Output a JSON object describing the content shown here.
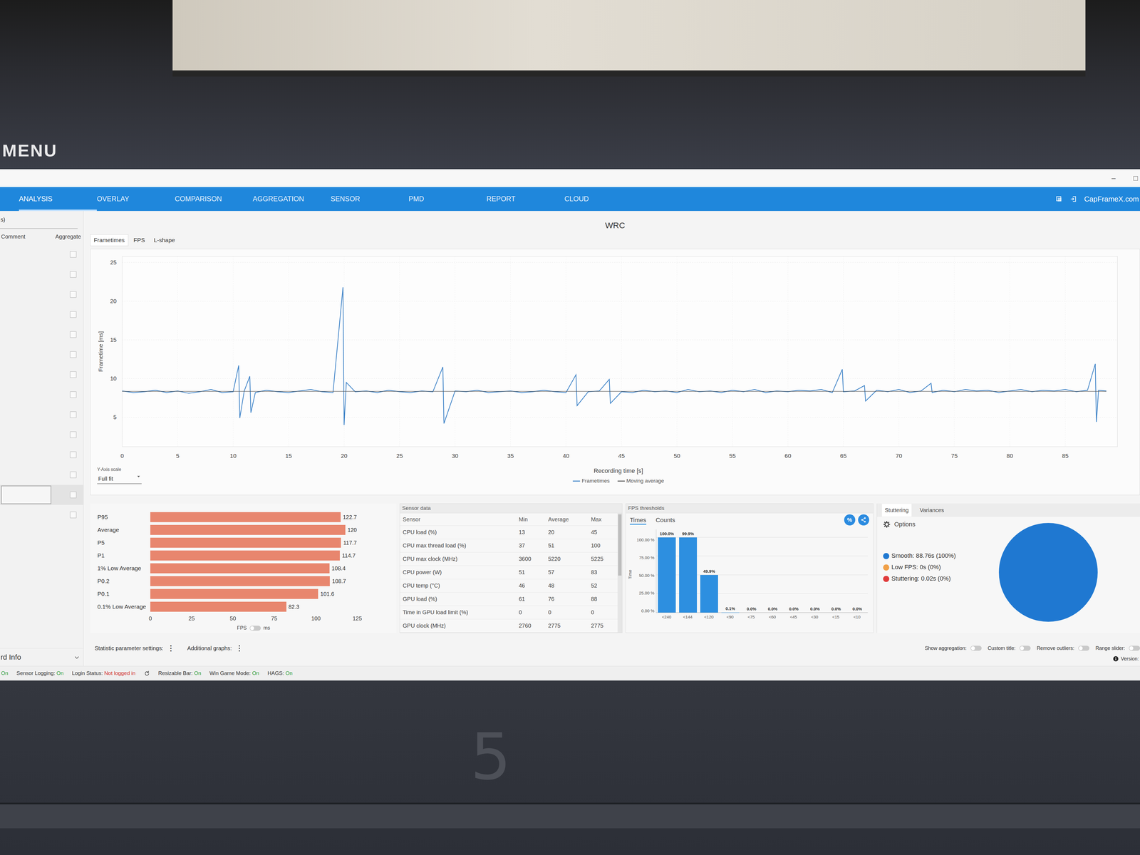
{
  "background": {
    "menu_label": "MENU",
    "counter": "5"
  },
  "window": {
    "controls": [
      "–",
      "□"
    ]
  },
  "nav": {
    "tabs": [
      {
        "label": "ANALYSIS",
        "selected": true
      },
      {
        "label": "OVERLAY",
        "selected": false
      },
      {
        "label": "COMPARISON",
        "selected": false
      },
      {
        "label": "AGGREGATION",
        "selected": false
      },
      {
        "label": "SENSOR",
        "selected": false
      },
      {
        "label": "PMD",
        "selected": false
      },
      {
        "label": "REPORT",
        "selected": false
      },
      {
        "label": "CLOUD",
        "selected": false
      }
    ],
    "site": "CapFrameX.com"
  },
  "sidebar": {
    "header_cut": "s)",
    "columns": [
      "Comment",
      "Aggregate"
    ],
    "rows": [
      {
        "checked": false,
        "selected": false
      },
      {
        "checked": false,
        "selected": false
      },
      {
        "checked": false,
        "selected": false
      },
      {
        "checked": false,
        "selected": false
      },
      {
        "checked": false,
        "selected": false
      },
      {
        "checked": false,
        "selected": false
      },
      {
        "checked": false,
        "selected": false
      },
      {
        "checked": false,
        "selected": false
      },
      {
        "checked": false,
        "selected": false
      },
      {
        "checked": false,
        "selected": false
      },
      {
        "checked": false,
        "selected": false
      },
      {
        "checked": false,
        "selected": false
      },
      {
        "checked": false,
        "selected": true
      },
      {
        "checked": false,
        "selected": false
      }
    ],
    "footer": "rd Info"
  },
  "chart": {
    "title": "WRC",
    "tabs": [
      {
        "label": "Frametimes",
        "selected": true
      },
      {
        "label": "FPS",
        "selected": false
      },
      {
        "label": "L-shape",
        "selected": false
      }
    ],
    "y_axis": {
      "label": "Frametime [ms]",
      "ticks": [
        "5",
        "10",
        "15",
        "20",
        "25"
      ],
      "min": 1.2,
      "max": 25.8
    },
    "x_axis": {
      "label": "Recording time [s]",
      "ticks": [
        "0",
        "5",
        "10",
        "15",
        "20",
        "25",
        "30",
        "35",
        "40",
        "45",
        "50",
        "55",
        "60",
        "65",
        "70",
        "75",
        "80",
        "85"
      ],
      "max": 89.7
    },
    "y_scale": {
      "label": "Y-Axis scale",
      "value": "Full fit"
    },
    "series": [
      {
        "name": "Frametimes",
        "color": "#3a80c6",
        "points": [
          [
            0,
            8.4
          ],
          [
            1,
            8.2
          ],
          [
            2,
            8.3
          ],
          [
            3,
            8.5
          ],
          [
            4,
            8.2
          ],
          [
            5,
            8.4
          ],
          [
            6,
            8.1
          ],
          [
            7,
            8.3
          ],
          [
            8,
            8.6
          ],
          [
            9,
            8.2
          ],
          [
            10,
            8.3
          ],
          [
            10.5,
            11.7
          ],
          [
            10.6,
            4.9
          ],
          [
            11,
            8.4
          ],
          [
            11.5,
            10.3
          ],
          [
            11.6,
            5.6
          ],
          [
            12,
            8.2
          ],
          [
            13,
            8.5
          ],
          [
            14,
            8.3
          ],
          [
            15,
            8.2
          ],
          [
            16,
            8.4
          ],
          [
            17,
            8.6
          ],
          [
            18,
            8.3
          ],
          [
            19,
            8.2
          ],
          [
            19.9,
            21.8
          ],
          [
            20,
            4
          ],
          [
            20.2,
            9.5
          ],
          [
            21,
            8.3
          ],
          [
            22,
            8.4
          ],
          [
            23,
            8.2
          ],
          [
            24,
            8.5
          ],
          [
            25,
            8.3
          ],
          [
            26,
            8.2
          ],
          [
            27,
            8.4
          ],
          [
            28,
            8.3
          ],
          [
            28.9,
            11.5
          ],
          [
            29,
            4.2
          ],
          [
            30,
            8.4
          ],
          [
            31,
            8.3
          ],
          [
            32,
            8.5
          ],
          [
            33,
            8.2
          ],
          [
            34,
            8.3
          ],
          [
            35,
            8.4
          ],
          [
            36,
            8.2
          ],
          [
            37,
            8.3
          ],
          [
            38,
            8.5
          ],
          [
            39,
            8.3
          ],
          [
            40,
            8.2
          ],
          [
            40.9,
            10.5
          ],
          [
            41,
            6.5
          ],
          [
            42,
            8.3
          ],
          [
            43,
            8.4
          ],
          [
            43.9,
            9.9
          ],
          [
            44,
            6.8
          ],
          [
            45,
            8.3
          ],
          [
            46,
            8.2
          ],
          [
            47,
            8.5
          ],
          [
            48,
            8.3
          ],
          [
            49,
            8.4
          ],
          [
            50,
            8.2
          ],
          [
            51,
            8.6
          ],
          [
            52,
            8.3
          ],
          [
            53,
            8.4
          ],
          [
            54,
            8.2
          ],
          [
            55,
            8.5
          ],
          [
            56,
            8.3
          ],
          [
            57,
            8.6
          ],
          [
            58,
            8.2
          ],
          [
            59,
            8.4
          ],
          [
            60,
            8.3
          ],
          [
            61,
            8.5
          ],
          [
            62,
            8.4
          ],
          [
            63,
            8.6
          ],
          [
            64,
            8.2
          ],
          [
            64.9,
            11.2
          ],
          [
            65,
            8.3
          ],
          [
            66,
            8.4
          ],
          [
            66.9,
            9.1
          ],
          [
            67,
            7.1
          ],
          [
            68,
            8.5
          ],
          [
            69,
            8.3
          ],
          [
            70,
            8.6
          ],
          [
            71,
            8.2
          ],
          [
            72,
            8.4
          ],
          [
            72.9,
            9.4
          ],
          [
            73,
            8.2
          ],
          [
            74,
            8.5
          ],
          [
            75,
            8.3
          ],
          [
            76,
            8.6
          ],
          [
            77,
            8.4
          ],
          [
            78,
            8.5
          ],
          [
            79,
            8.2
          ],
          [
            80,
            8.4
          ],
          [
            81,
            8.6
          ],
          [
            82,
            8.3
          ],
          [
            83,
            8.5
          ],
          [
            84,
            8.4
          ],
          [
            85,
            8.6
          ],
          [
            86,
            8.3
          ],
          [
            87,
            8.5
          ],
          [
            87.7,
            11.9
          ],
          [
            87.8,
            4.4
          ],
          [
            88,
            8.5
          ],
          [
            88.7,
            8.4
          ]
        ]
      },
      {
        "name": "Moving average",
        "color": "#555555",
        "points": [
          [
            0,
            8.35
          ],
          [
            88.7,
            8.35
          ]
        ]
      }
    ]
  },
  "stats": {
    "max": 125,
    "bars": [
      {
        "label": "P95",
        "value": "122.7",
        "fps": 122.7
      },
      {
        "label": "Average",
        "value": "120",
        "fps": 120
      },
      {
        "label": "P5",
        "value": "117.7",
        "fps": 117.7
      },
      {
        "label": "P1",
        "value": "114.7",
        "fps": 114.7
      },
      {
        "label": "1% Low Average",
        "value": "108.4",
        "fps": 108.4
      },
      {
        "label": "P0.2",
        "value": "108.7",
        "fps": 108.7
      },
      {
        "label": "P0.1",
        "value": "101.6",
        "fps": 101.6
      },
      {
        "label": "0.1% Low Average",
        "value": "82.3",
        "fps": 82.3
      }
    ],
    "ticks": [
      "0",
      "25",
      "50",
      "75",
      "100",
      "125"
    ],
    "unit_toggle": {
      "left": "FPS",
      "right": "ms",
      "on": false
    }
  },
  "sensors": {
    "title": "Sensor data",
    "columns": [
      "Sensor",
      "Min",
      "Average",
      "Max"
    ],
    "rows": [
      [
        "CPU load (%)",
        "13",
        "20",
        "45"
      ],
      [
        "CPU max thread load (%)",
        "37",
        "51",
        "100"
      ],
      [
        "CPU max clock (MHz)",
        "3600",
        "5220",
        "5225"
      ],
      [
        "CPU power (W)",
        "51",
        "57",
        "83"
      ],
      [
        "CPU temp (°C)",
        "46",
        "48",
        "52"
      ],
      [
        "GPU load (%)",
        "61",
        "76",
        "88"
      ],
      [
        "Time in GPU load limit (%)",
        "0",
        "0",
        "0"
      ],
      [
        "GPU clock (MHz)",
        "2760",
        "2775",
        "2775"
      ]
    ]
  },
  "thresholds": {
    "title": "FPS thresholds",
    "tabs": [
      {
        "label": "Times",
        "selected": true
      },
      {
        "label": "Counts",
        "selected": false
      }
    ],
    "percent_button": "%",
    "axis_label": "Time",
    "y_ticks": [
      "100.00 %",
      "75.00 %",
      "50.00 %",
      "25.00 %",
      "0.00 %"
    ],
    "bars": [
      {
        "label": "<240",
        "value": "100.0%",
        "level": 1.0
      },
      {
        "label": "<144",
        "value": "99.9%",
        "level": 0.999
      },
      {
        "label": "<120",
        "value": "49.9%",
        "level": 0.499
      },
      {
        "label": "<90",
        "value": "0.1%",
        "level": 0.001
      },
      {
        "label": "<75",
        "value": "0.0%",
        "level": 0
      },
      {
        "label": "<60",
        "value": "0.0%",
        "level": 0
      },
      {
        "label": "<45",
        "value": "0.0%",
        "level": 0
      },
      {
        "label": "<30",
        "value": "0.0%",
        "level": 0
      },
      {
        "label": "<15",
        "value": "0.0%",
        "level": 0
      },
      {
        "label": "<10",
        "value": "0.0%",
        "level": 0
      }
    ]
  },
  "stuttering": {
    "tabs": [
      {
        "label": "Stuttering",
        "selected": true
      },
      {
        "label": "Variances",
        "selected": false
      }
    ],
    "options": "Options",
    "items": [
      {
        "label": "Smooth: 88.76s (100%)",
        "seconds": 88.76,
        "color": "#1f78d1"
      },
      {
        "label": "Low FPS: 0s (0%)",
        "seconds": 0,
        "color": "#f0a048"
      },
      {
        "label": "Stuttering: 0.02s (0%)",
        "seconds": 0.02,
        "color": "#e03a3a"
      }
    ]
  },
  "footer": {
    "settings": [
      {
        "label": "Statistic parameter settings:",
        "icon": "⋮"
      },
      {
        "label": "Additional graphs:",
        "icon": "⋮"
      }
    ],
    "toggles": [
      {
        "label": "Show aggregation:",
        "on": false
      },
      {
        "label": "Custom title:",
        "on": false
      },
      {
        "label": "Remove outliers:",
        "on": false
      },
      {
        "label": "Range slider:",
        "on": false
      }
    ],
    "version": "Version:"
  },
  "status_bar": [
    {
      "value": "On",
      "color": "#2e9d3a"
    },
    {
      "label": "Sensor Logging:",
      "value": "On",
      "color": "#2e9d3a"
    },
    {
      "label": "Login Status:",
      "value": "Not logged in",
      "color": "#d03030"
    },
    {
      "label": "Resizable Bar:",
      "value": "On",
      "color": "#2e9d3a"
    },
    {
      "label": "Win Game Mode:",
      "value": "On",
      "color": "#2e9d3a"
    },
    {
      "label": "HAGS:",
      "value": "On",
      "color": "#2e9d3a"
    }
  ]
}
